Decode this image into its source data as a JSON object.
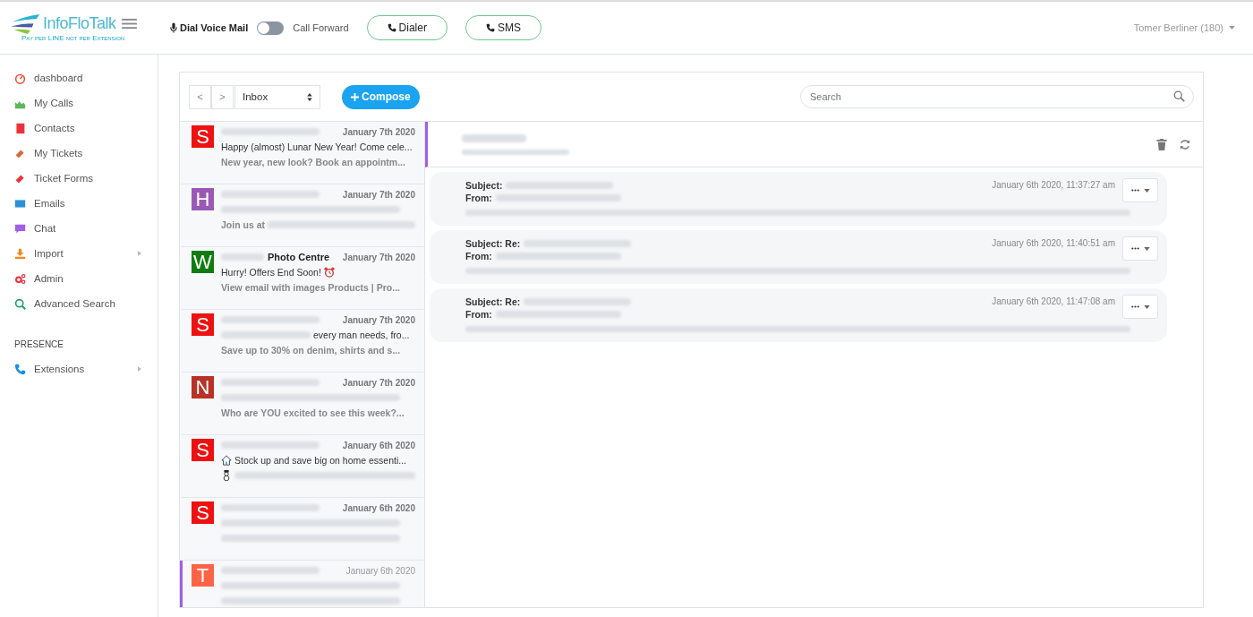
{
  "header": {
    "logo": {
      "name": "InfoFloTalk",
      "tagline": "Pay per LINE not per Extension"
    },
    "voice_mail": "Dial Voice Mail",
    "call_forward": {
      "label": "Call Forward",
      "on": false
    },
    "buttons": [
      {
        "label": "Dialer",
        "kind": "phone"
      },
      {
        "label": "SMS",
        "kind": "phone"
      }
    ],
    "user": "Tomer Berliner (180)"
  },
  "sidebar": {
    "items": [
      {
        "label": "dashboard",
        "color": "#f0533a",
        "submenu": false
      },
      {
        "label": "My Calls",
        "color": "#5cb85c",
        "submenu": false
      },
      {
        "label": "Contacts",
        "color": "#e8343f",
        "submenu": false
      },
      {
        "label": "My Tickets",
        "color": "#d9683a",
        "submenu": false
      },
      {
        "label": "Ticket Forms",
        "color": "#e8343f",
        "submenu": false
      },
      {
        "label": "Emails",
        "color": "#2b8fd6",
        "submenu": false
      },
      {
        "label": "Chat",
        "color": "#a15ee8",
        "submenu": false
      },
      {
        "label": "Import",
        "color": "#f08a24",
        "submenu": true
      },
      {
        "label": "Admin",
        "color": "#e8343f",
        "submenu": false
      },
      {
        "label": "Advanced Search",
        "color": "#1e9e6a",
        "submenu": false
      }
    ],
    "section": "PRESENCE",
    "section_items": [
      {
        "label": "Extensions",
        "color": "#1a8fe0",
        "submenu": true
      }
    ]
  },
  "toolbar": {
    "prev": "<",
    "next": ">",
    "folder": "Inbox",
    "compose": "Compose",
    "search_placeholder": "Search"
  },
  "messages": [
    {
      "letter": "S",
      "color": "#ee1111",
      "date": "January 7th 2020",
      "selected": false,
      "lines": [
        {
          "text": "Happy (almost) Lunar New Year! Come cele...",
          "bold": false
        },
        {
          "text": "New year, new look? Book an appointm...",
          "bold": true
        }
      ]
    },
    {
      "letter": "H",
      "color": "#9b59b6",
      "date": "January 7th 2020",
      "selected": false,
      "lines": [
        {
          "blurred": true
        },
        {
          "text": "Join us at",
          "bold": true,
          "blur_after": true
        }
      ]
    },
    {
      "letter": "W",
      "color": "#107c10",
      "sender": "Photo Centre",
      "date": "January 7th 2020",
      "selected": false,
      "lines": [
        {
          "text": "Hurry! Offers End Soon!",
          "bold": false,
          "alarm": true
        },
        {
          "text": "View email with images Products | Pro...",
          "bold": true
        }
      ]
    },
    {
      "letter": "S",
      "color": "#ee1111",
      "date": "January 7th 2020",
      "selected": false,
      "lines": [
        {
          "text": "every man needs, fro...",
          "bold": false,
          "blur_before": true
        },
        {
          "text": "Save up to 30% on denim, shirts and s...",
          "bold": true
        }
      ]
    },
    {
      "letter": "N",
      "color": "#b83227",
      "date": "January 7th 2020",
      "selected": false,
      "lines": [
        {
          "blurred": true
        },
        {
          "text": "Who are YOU excited to see this week?...",
          "bold": true
        }
      ]
    },
    {
      "letter": "S",
      "color": "#ee1111",
      "date": "January 6th 2020",
      "selected": false,
      "lines": [
        {
          "text": "Stock up and save big on home essenti...",
          "bold": false,
          "house": true
        },
        {
          "snowman": true,
          "blur_after": true
        }
      ]
    },
    {
      "letter": "S",
      "color": "#ee1111",
      "date": "January 6th 2020",
      "selected": false,
      "lines": [
        {
          "blurred": true
        },
        {
          "blurred": true
        }
      ]
    },
    {
      "letter": "T",
      "color": "#ff6347",
      "date": "January 6th 2020",
      "selected": true,
      "lines": [
        {
          "blurred": true
        },
        {
          "blurred": true
        }
      ]
    }
  ],
  "thread": {
    "emails": [
      {
        "subject": "Subject:",
        "from": "From:",
        "time": "January 6th 2020, 11:37:27 am"
      },
      {
        "subject": "Subject: Re:",
        "from": "From:",
        "time": "January 6th 2020, 11:40:51 am"
      },
      {
        "subject": "Subject: Re:",
        "from": "From:",
        "time": "January 6th 2020, 11:47:08 am"
      }
    ]
  }
}
